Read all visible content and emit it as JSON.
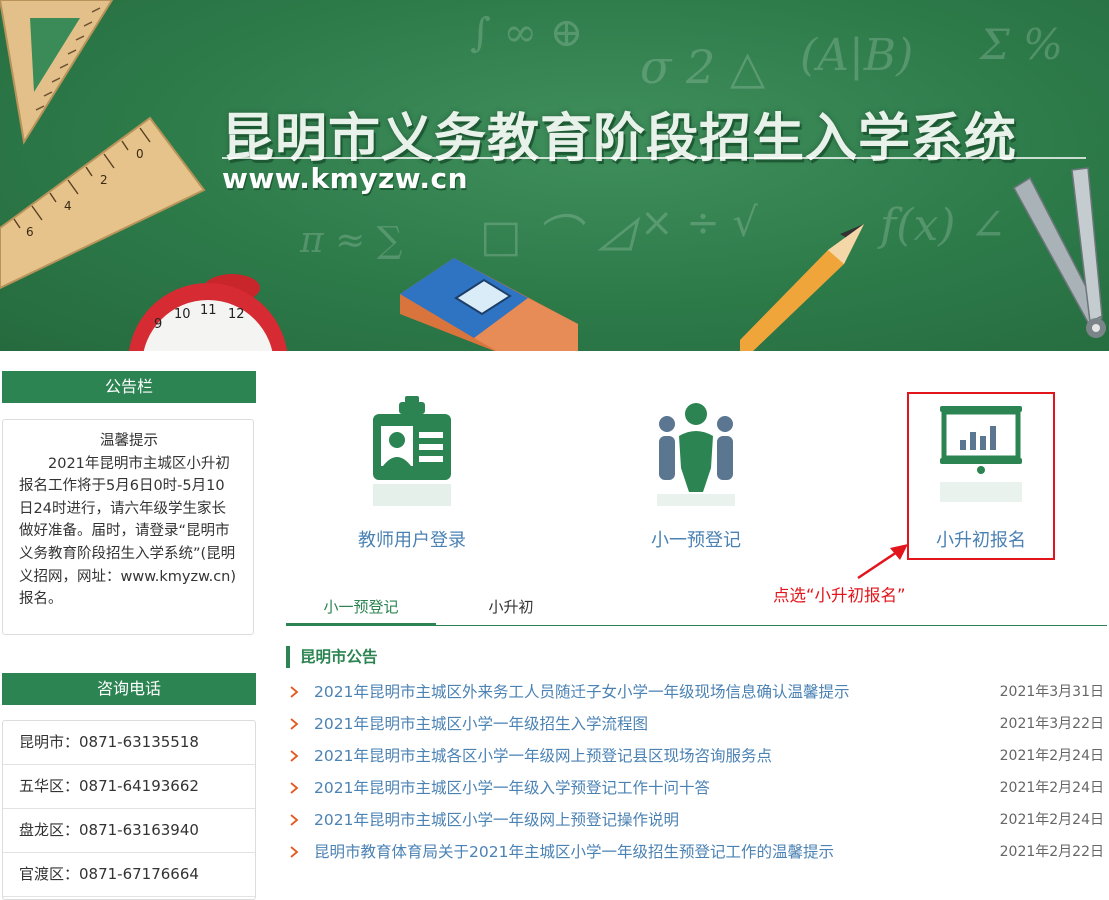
{
  "header": {
    "title": "昆明市义务教育阶段招生入学系统",
    "url": "www.kmyzw.cn"
  },
  "notice_panel": {
    "heading": "公告栏",
    "title": "温馨提示",
    "body": "2021年昆明市主城区小升初报名工作将于5月6日0时-5月10日24时进行，请六年级学生家长做好准备。届时，请登录“昆明市义务教育阶段招生入学系统”(昆明义招网，网址：www.kmyzw.cn)报名。"
  },
  "contact_panel": {
    "heading": "咨询电话",
    "rows": [
      {
        "text": "昆明市：0871-63135518"
      },
      {
        "text": "五华区：0871-64193662"
      },
      {
        "text": "盘龙区：0871-63163940"
      },
      {
        "text": "官渡区：0871-67176664"
      }
    ]
  },
  "entries": {
    "teacher_login": {
      "label": "教师用户登录",
      "icon": "id-badge-icon"
    },
    "grade1_register": {
      "label": "小一预登记",
      "icon": "people-group-icon"
    },
    "junior_apply": {
      "label": "小升初报名",
      "icon": "presentation-board-icon"
    }
  },
  "annotation": {
    "hint": "点选“小升初报名”",
    "color": "#e2151c"
  },
  "tabs": [
    {
      "label": "小一预登记",
      "active": true
    },
    {
      "label": "小升初",
      "active": false
    }
  ],
  "announcements": {
    "heading": "昆明市公告",
    "items": [
      {
        "title": "2021年昆明市主城区外来务工人员随迁子女小学一年级现场信息确认温馨提示",
        "date": "2021年3月31日"
      },
      {
        "title": "2021年昆明市主城区小学一年级招生入学流程图",
        "date": "2021年3月22日"
      },
      {
        "title": "2021年昆明市主城各区小学一年级网上预登记县区现场咨询服务点",
        "date": "2021年2月24日"
      },
      {
        "title": "2021年昆明市主城区小学一年级入学预登记工作十问十答",
        "date": "2021年2月24日"
      },
      {
        "title": "2021年昆明市主城区小学一年级网上预登记操作说明",
        "date": "2021年2月24日"
      },
      {
        "title": "昆明市教育体育局关于2021年主城区小学一年级招生预登记工作的温馨提示",
        "date": "2021年2月22日"
      }
    ]
  },
  "colors": {
    "brand_green": "#2b8451",
    "link_blue": "#4b82b4",
    "icon_slate": "#5a7690"
  }
}
